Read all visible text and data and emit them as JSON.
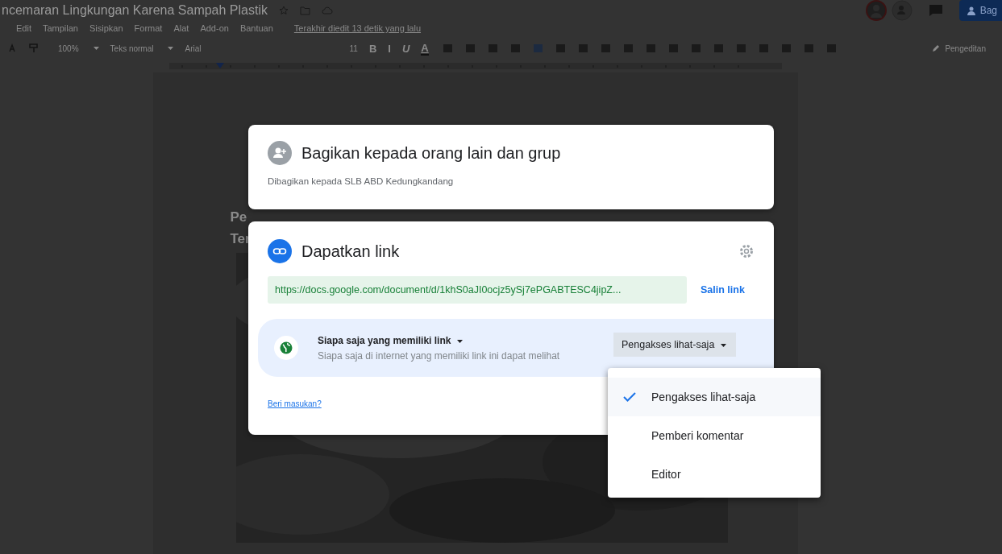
{
  "document": {
    "title": "ncemaran Lingkungan Karena Sampah Plastik",
    "last_edit": "Terakhir diedit 13 detik yang lalu",
    "share_button": "Bag",
    "editing_mode": "Pengeditan"
  },
  "menu": [
    "Edit",
    "Tampilan",
    "Sisipkan",
    "Format",
    "Alat",
    "Add-on",
    "Bantuan"
  ],
  "toolbar": {
    "zoom": "100%",
    "style": "Teks normal",
    "font": "Arial",
    "size": "11",
    "format_buttons": [
      "B",
      "I",
      "U",
      "A"
    ]
  },
  "doc_text": [
    "Pe",
    "Ter"
  ],
  "photo": {
    "kind": "picture"
  },
  "share_card": {
    "title": "Bagikan kepada orang lain dan grup",
    "subtitle": "Dibagikan kepada SLB ABD Kedungkandang"
  },
  "link_card": {
    "title": "Dapatkan link",
    "url": "https://docs.google.com/document/d/1khS0aJI0ocjz5ySj7ePGABTESC4jipZ...",
    "copy_label": "Salin link",
    "access": {
      "scope": "Siapa saja yang memiliki link",
      "description": "Siapa saja di internet yang memiliki link ini dapat melihat",
      "role": "Pengakses lihat-saja"
    },
    "feedback": "Beri masukan?"
  },
  "role_menu": [
    {
      "label": "Pengakses lihat-saja",
      "selected": true
    },
    {
      "label": "Pemberi komentar",
      "selected": false
    },
    {
      "label": "Editor",
      "selected": false
    }
  ]
}
